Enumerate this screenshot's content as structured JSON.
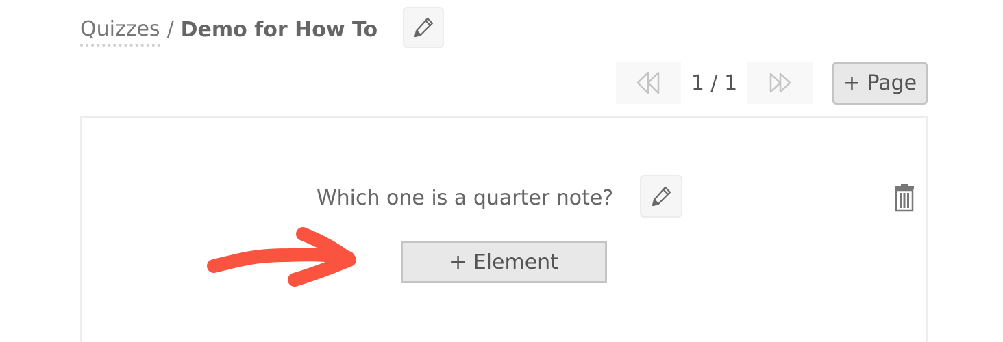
{
  "breadcrumb": {
    "parent_label": "Quizzes",
    "separator": "/",
    "current_label": "Demo for How To"
  },
  "pager": {
    "indicator": "1 / 1",
    "current_page": 1,
    "total_pages": 1,
    "add_page_label": "+ Page"
  },
  "question": {
    "text": "Which one is a quarter note?",
    "add_element_label": "+ Element"
  },
  "icons": {
    "title_edit": "pencil-icon",
    "question_edit": "pencil-icon",
    "first_page": "double-chevron-left-icon",
    "last_page": "double-chevron-right-icon",
    "delete": "trash-icon"
  },
  "colors": {
    "text": "#666666",
    "button_bg": "#e8e8e8",
    "button_border": "#c4c4c4",
    "annotation_arrow": "#fa5440"
  }
}
